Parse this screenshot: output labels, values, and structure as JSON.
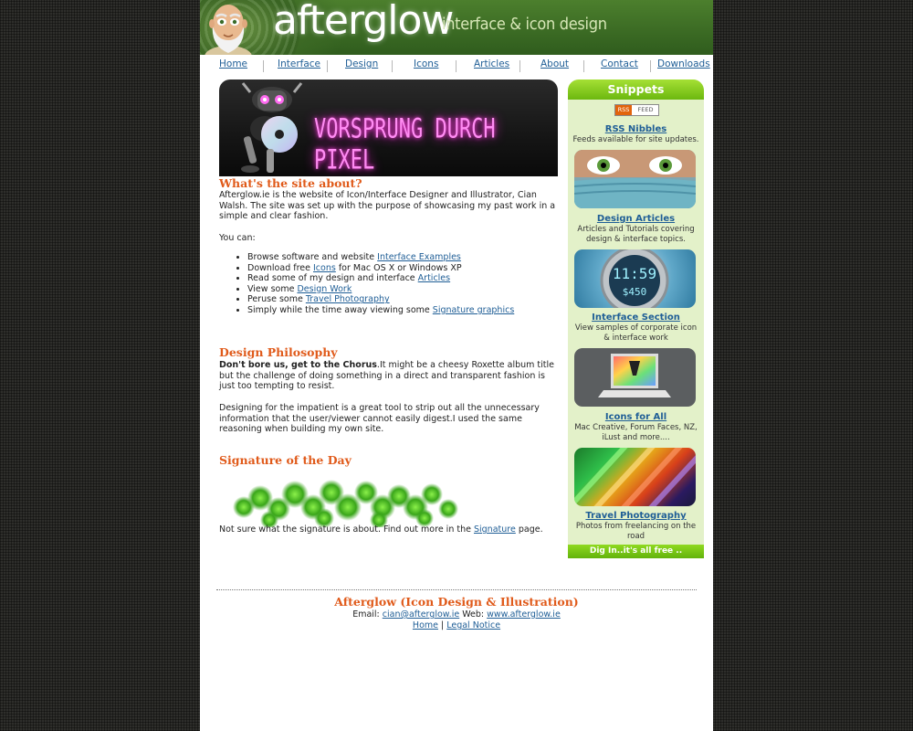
{
  "header": {
    "brand": "afterglow",
    "tagline": "interface & icon design"
  },
  "nav": [
    {
      "label": "Home"
    },
    {
      "label": "Interface"
    },
    {
      "label": "Design"
    },
    {
      "label": "Icons"
    },
    {
      "label": "Articles"
    },
    {
      "label": "About"
    },
    {
      "label": "Contact"
    },
    {
      "label": "Downloads"
    }
  ],
  "banner": {
    "text": "VORSPRUNG DURCH PIXEL"
  },
  "about": {
    "heading": "What's the site about?",
    "intro": "Afterglow.ie is the website of Icon/Interface Designer and Illustrator, Cian Walsh. The site was set up with the purpose of showcasing my past work in a simple and clear fashion.",
    "you_can": "You can:",
    "items": [
      {
        "pre": "Browse software and website ",
        "link": "Interface Examples",
        "post": ""
      },
      {
        "pre": "Download free ",
        "link": "Icons",
        "post": " for Mac OS X or Windows XP"
      },
      {
        "pre": "Read some of my design and interface ",
        "link": "Articles",
        "post": ""
      },
      {
        "pre": "View some ",
        "link": "Design Work",
        "post": ""
      },
      {
        "pre": "Peruse some ",
        "link": "Travel Photography",
        "post": ""
      },
      {
        "pre": "Simply while the time away viewing some ",
        "link": "Signature graphics",
        "post": ""
      }
    ]
  },
  "philosophy": {
    "heading": "Design Philosophy",
    "bold": "Don't bore us, get to the Chorus",
    "p1_rest": ".It might be a cheesy Roxette album title but the challenge of doing something in a direct and transparent fashion is just too tempting to resist.",
    "p2": "Designing for the impatient is a great tool to strip out all the unnecessary information that the user/viewer cannot easily digest.I used the same reasoning when building my own site."
  },
  "signature": {
    "heading": "Signature of the Day",
    "text_pre": "Not sure what the signature is about. Find out more in the ",
    "link": "Signature",
    "text_post": " page."
  },
  "sidebar": {
    "title": "Snippets",
    "rss_left": "RSS",
    "rss_right": "FEED",
    "items": [
      {
        "title": "RSS Nibbles",
        "desc": "Feeds available for site updates."
      },
      {
        "title": "Design Articles",
        "desc": "Articles and Tutorials covering design & interface topics."
      },
      {
        "title": "Interface Section",
        "desc": "View samples of corporate icon & interface work",
        "clock_top": "11:59",
        "clock_bottom": "$450"
      },
      {
        "title": "Icons for All",
        "desc": "Mac Creative, Forum Faces, NZ, iLust and more...."
      },
      {
        "title": "Travel Photography",
        "desc": "Photos from freelancing on the road"
      }
    ],
    "footer": "Dig In..it's all free .."
  },
  "footer": {
    "title": "Afterglow (Icon Design & Illustration)",
    "email_label": "Email: ",
    "email": "cian@afterglow.ie",
    "web_label": " Web: ",
    "web": "www.afterglow.ie",
    "home": "Home",
    "sep": " | ",
    "legal": "Legal Notice"
  },
  "colors": {
    "accent": "#e05a1a",
    "link": "#1f5e96",
    "sidebar_bg": "#e3f1c9",
    "sidebar_head": "#7cc81a",
    "header_green": "#3f6f27"
  }
}
